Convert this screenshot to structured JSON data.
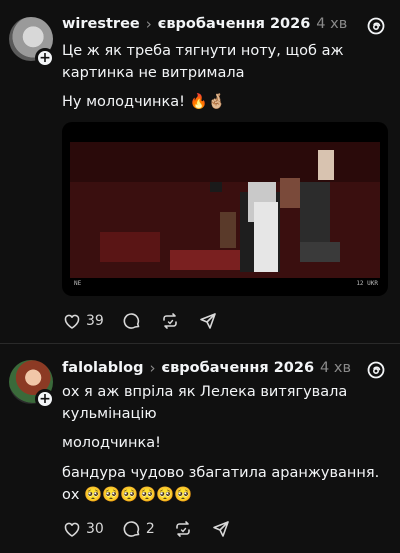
{
  "posts": [
    {
      "username": "wirestree",
      "topic": "євробачення 2026",
      "time": "4 хв",
      "text1": "Це ж як треба тягнути ноту, щоб аж картинка не витримала",
      "text2": "Ну молодчинка! 🔥🤞🏼",
      "media_caption_left": "NE",
      "media_caption_right": "12 UKR",
      "likes": "39",
      "replies": "",
      "colors": {
        "accent": "#f3f5f7",
        "muted": "#8a8a8a"
      }
    },
    {
      "username": "falolablog",
      "topic": "євробачення 2026",
      "time": "4 хв",
      "text1": "ох я аж впріла як Лелека витягувала кульмінацію",
      "text2": "молодчинка!",
      "text3": "бандура чудово збагатила аранжування. ох 🥺🥺🥺🥺🥺🥺",
      "likes": "30",
      "replies": "2"
    }
  ],
  "icons": {
    "follow": "plus-icon",
    "threads": "threads-logo-icon",
    "like": "heart-icon",
    "reply": "comment-icon",
    "repost": "repost-icon",
    "share": "send-icon"
  }
}
